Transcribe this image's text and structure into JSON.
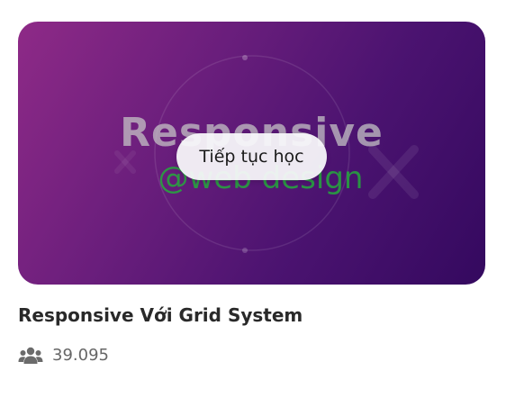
{
  "course": {
    "thumbnail": {
      "title_text": "Responsive",
      "subtitle_text": "@web design",
      "gradient_start": "#8e2a87",
      "gradient_end": "#34095f"
    },
    "continue_label": "Tiếp tục học",
    "title": "Responsive Với Grid System",
    "learners": {
      "icon": "users-icon",
      "count": "39.095"
    }
  }
}
